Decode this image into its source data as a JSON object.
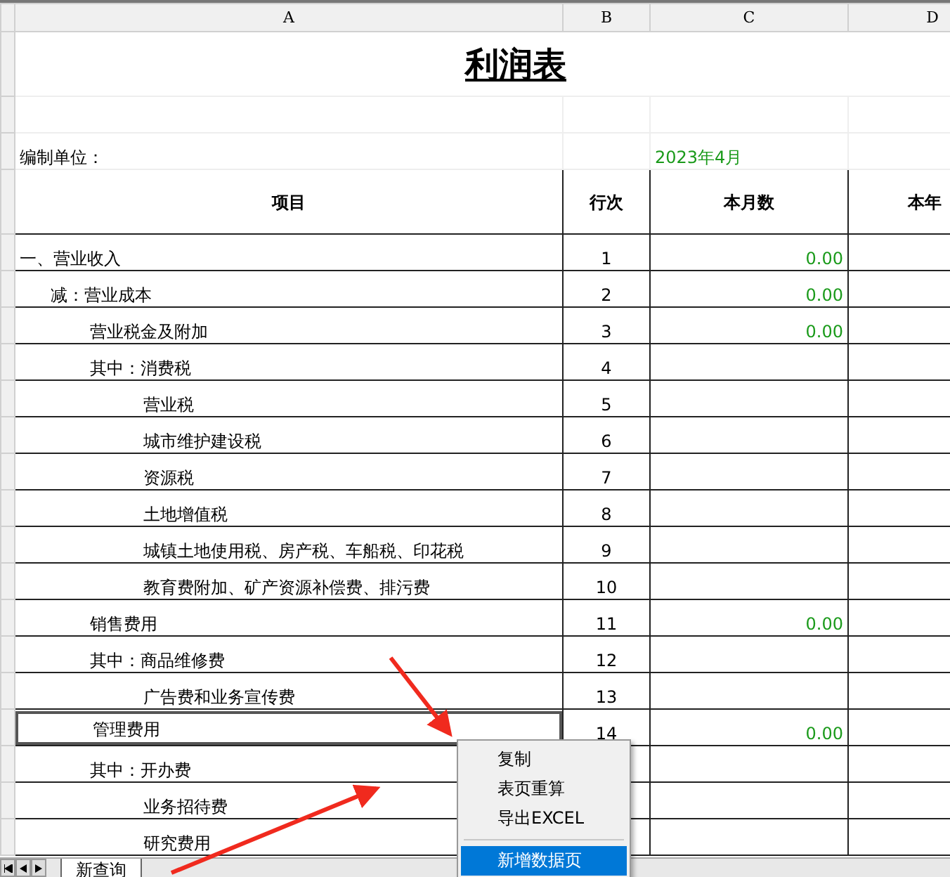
{
  "sheet": {
    "columns": [
      "A",
      "B",
      "C",
      "D"
    ],
    "title": "利润表",
    "unit_label": "编制单位：",
    "period": "2023年4月",
    "headers": [
      "项目",
      "行次",
      "本月数",
      "本年"
    ],
    "rows": [
      {
        "item": "一、营业收入",
        "line": "1",
        "month": "0.00",
        "selected": false,
        "children": [
          {
            "item": "减：营业成本",
            "line": "2",
            "month": "0.00",
            "selected": false,
            "children": [
              {
                "item": "营业税金及附加",
                "line": "3",
                "month": "0.00",
                "selected": false
              },
              {
                "item": "其中：消费税",
                "line": "4",
                "selected": false,
                "children": [
                  {
                    "item": "营业税",
                    "line": "5",
                    "selected": false
                  },
                  {
                    "item": "城市维护建设税",
                    "line": "6",
                    "selected": false
                  },
                  {
                    "item": "资源税",
                    "line": "7",
                    "selected": false
                  },
                  {
                    "item": "土地增值税",
                    "line": "8",
                    "selected": false
                  },
                  {
                    "item": "城镇土地使用税、房产税、车船税、印花税",
                    "line": "9",
                    "selected": false
                  },
                  {
                    "item": "教育费附加、矿产资源补偿费、排污费",
                    "line": "10",
                    "selected": false
                  }
                ]
              },
              {
                "item": "销售费用",
                "line": "11",
                "month": "0.00",
                "selected": false
              },
              {
                "item": "其中：商品维修费",
                "line": "12",
                "selected": false,
                "children": [
                  {
                    "item": "广告费和业务宣传费",
                    "line": "13",
                    "selected": false
                  }
                ]
              },
              {
                "item": "管理费用",
                "line": "14",
                "month": "0.00",
                "selected": true
              },
              {
                "item": "其中：开办费",
                "selected": false,
                "children": [
                  {
                    "item": "业务招待费",
                    "selected": false
                  },
                  {
                    "item": "研究费用",
                    "selected": false
                  }
                ]
              }
            ]
          }
        ]
      }
    ],
    "tabs": [
      {
        "label": "新查询",
        "selected": true
      }
    ]
  },
  "context_menu": {
    "items": [
      {
        "label": "复制",
        "selected": false,
        "separator_before": false
      },
      {
        "label": "表页重算",
        "selected": false,
        "separator_before": false
      },
      {
        "label": "导出EXCEL",
        "selected": false,
        "separator_before": false
      },
      {
        "label": "新增数据页",
        "selected": true,
        "separator_before": true
      }
    ]
  }
}
